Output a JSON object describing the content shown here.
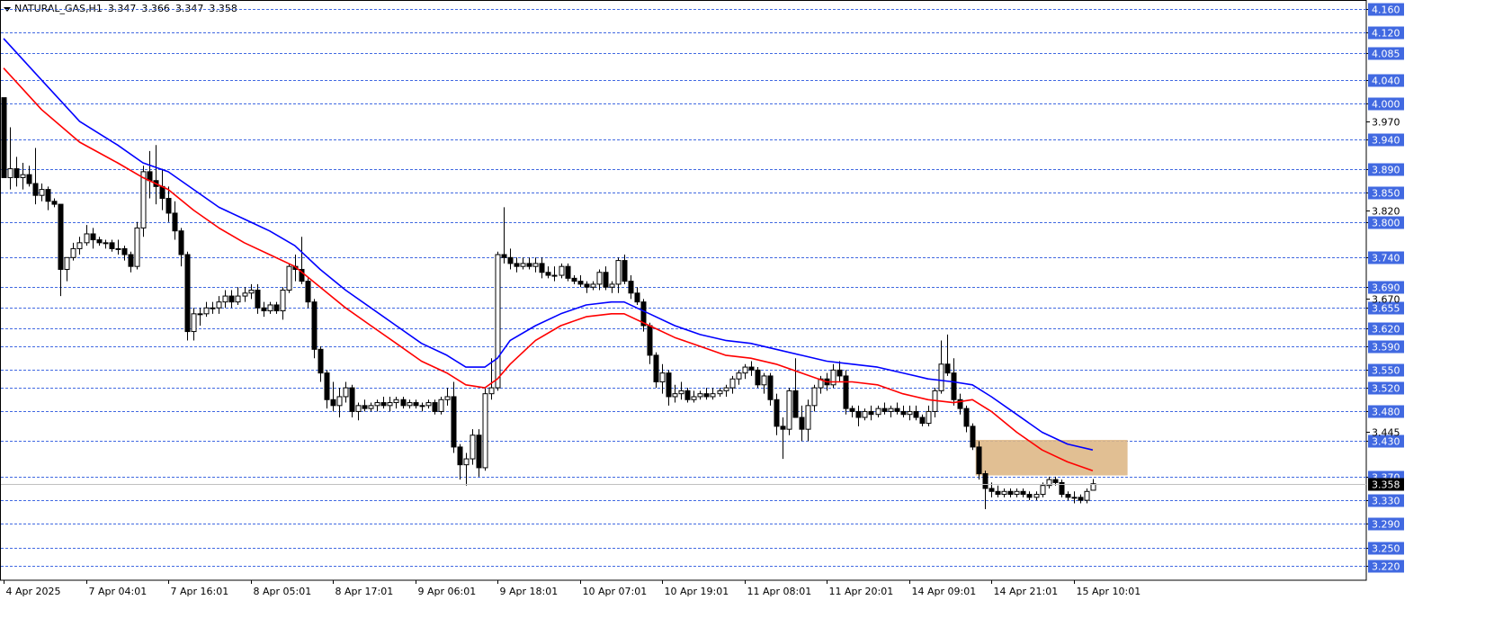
{
  "header": {
    "symbol_label": "NATURAL_GAS,H1",
    "open": "3.347",
    "high": "3.366",
    "low": "3.347",
    "close": "3.358"
  },
  "colors": {
    "background": "#ffffff",
    "grid": "#4169e1",
    "candle": "#000000",
    "ma_fast": "#ff0000",
    "ma_slow": "#0000ff",
    "zone": "#deb887",
    "price_tag_bg": "#4169e1",
    "price_tag_text": "#ffffff",
    "current_tag_bg": "#000000"
  },
  "chart_data": {
    "type": "candlestick",
    "ylim": [
      3.195,
      4.175
    ],
    "grid_levels": [
      "4.160",
      "4.120",
      "4.085",
      "4.040",
      "4.000",
      "3.940",
      "3.890",
      "3.850",
      "3.800",
      "3.740",
      "3.690",
      "3.655",
      "3.620",
      "3.590",
      "3.550",
      "3.520",
      "3.480",
      "3.430",
      "3.370",
      "3.330",
      "3.290",
      "3.250",
      "3.220"
    ],
    "plain_ticks": [
      "3.970",
      "3.820",
      "3.670",
      "3.445"
    ],
    "current_price": "3.358",
    "x_tick_labels": [
      "4 Apr 2025",
      "7 Apr 04:01",
      "7 Apr 16:01",
      "8 Apr 05:01",
      "8 Apr 17:01",
      "9 Apr 06:01",
      "9 Apr 18:01",
      "10 Apr 07:01",
      "10 Apr 19:01",
      "11 Apr 08:01",
      "11 Apr 20:01",
      "14 Apr 09:01",
      "14 Apr 21:01",
      "15 Apr 10:01"
    ],
    "x_tick_bars": [
      0,
      13,
      26,
      39,
      52,
      65,
      78,
      91,
      104,
      117,
      130,
      143,
      156,
      169
    ],
    "candles": [
      [
        4.01,
        4.01,
        3.895,
        3.875
      ],
      [
        3.875,
        3.96,
        3.855,
        3.89
      ],
      [
        3.89,
        3.91,
        3.86,
        3.875
      ],
      [
        3.875,
        3.9,
        3.855,
        3.88
      ],
      [
        3.88,
        3.895,
        3.86,
        3.865
      ],
      [
        3.865,
        3.925,
        3.83,
        3.845
      ],
      [
        3.845,
        3.865,
        3.835,
        3.855
      ],
      [
        3.855,
        3.86,
        3.82,
        3.835
      ],
      [
        3.835,
        3.84,
        3.825,
        3.83
      ],
      [
        3.83,
        3.78,
        3.675,
        3.72
      ],
      [
        3.72,
        3.74,
        3.7,
        3.74
      ],
      [
        3.74,
        3.765,
        3.735,
        3.755
      ],
      [
        3.755,
        3.775,
        3.745,
        3.765
      ],
      [
        3.765,
        3.795,
        3.76,
        3.78
      ],
      [
        3.78,
        3.79,
        3.755,
        3.77
      ],
      [
        3.77,
        3.775,
        3.76,
        3.765
      ],
      [
        3.765,
        3.77,
        3.755,
        3.765
      ],
      [
        3.765,
        3.77,
        3.75,
        3.755
      ],
      [
        3.755,
        3.77,
        3.745,
        3.755
      ],
      [
        3.755,
        3.76,
        3.735,
        3.745
      ],
      [
        3.745,
        3.75,
        3.715,
        3.725
      ],
      [
        3.725,
        3.8,
        3.72,
        3.79
      ],
      [
        3.79,
        3.895,
        3.775,
        3.885
      ],
      [
        3.885,
        3.92,
        3.84,
        3.87
      ],
      [
        3.87,
        3.93,
        3.83,
        3.86
      ],
      [
        3.86,
        3.89,
        3.82,
        3.84
      ],
      [
        3.84,
        3.86,
        3.8,
        3.815
      ],
      [
        3.815,
        3.835,
        3.77,
        3.785
      ],
      [
        3.785,
        3.79,
        3.725,
        3.745
      ],
      [
        3.745,
        3.75,
        3.6,
        3.615
      ],
      [
        3.615,
        3.655,
        3.6,
        3.645
      ],
      [
        3.645,
        3.655,
        3.625,
        3.645
      ],
      [
        3.645,
        3.665,
        3.64,
        3.655
      ],
      [
        3.655,
        3.665,
        3.645,
        3.655
      ],
      [
        3.655,
        3.675,
        3.645,
        3.665
      ],
      [
        3.665,
        3.685,
        3.655,
        3.675
      ],
      [
        3.675,
        3.685,
        3.655,
        3.665
      ],
      [
        3.665,
        3.69,
        3.66,
        3.675
      ],
      [
        3.675,
        3.69,
        3.665,
        3.68
      ],
      [
        3.68,
        3.695,
        3.67,
        3.685
      ],
      [
        3.685,
        3.695,
        3.645,
        3.655
      ],
      [
        3.655,
        3.665,
        3.64,
        3.65
      ],
      [
        3.65,
        3.665,
        3.645,
        3.66
      ],
      [
        3.66,
        3.665,
        3.645,
        3.65
      ],
      [
        3.65,
        3.69,
        3.635,
        3.685
      ],
      [
        3.685,
        3.73,
        3.68,
        3.725
      ],
      [
        3.725,
        3.745,
        3.7,
        3.72
      ],
      [
        3.72,
        3.775,
        3.695,
        3.7
      ],
      [
        3.7,
        3.705,
        3.655,
        3.665
      ],
      [
        3.665,
        3.67,
        3.57,
        3.585
      ],
      [
        3.585,
        3.59,
        3.53,
        3.545
      ],
      [
        3.545,
        3.55,
        3.485,
        3.5
      ],
      [
        3.5,
        3.53,
        3.48,
        3.49
      ],
      [
        3.49,
        3.52,
        3.47,
        3.505
      ],
      [
        3.505,
        3.53,
        3.495,
        3.52
      ],
      [
        3.52,
        3.525,
        3.47,
        3.48
      ],
      [
        3.48,
        3.495,
        3.465,
        3.49
      ],
      [
        3.49,
        3.5,
        3.48,
        3.485
      ],
      [
        3.485,
        3.495,
        3.48,
        3.49
      ],
      [
        3.49,
        3.5,
        3.48,
        3.495
      ],
      [
        3.495,
        3.505,
        3.485,
        3.49
      ],
      [
        3.49,
        3.505,
        3.48,
        3.495
      ],
      [
        3.495,
        3.505,
        3.485,
        3.5
      ],
      [
        3.5,
        3.505,
        3.485,
        3.49
      ],
      [
        3.49,
        3.5,
        3.485,
        3.495
      ],
      [
        3.495,
        3.5,
        3.485,
        3.49
      ],
      [
        3.49,
        3.495,
        3.48,
        3.49
      ],
      [
        3.49,
        3.5,
        3.485,
        3.495
      ],
      [
        3.495,
        3.5,
        3.475,
        3.48
      ],
      [
        3.48,
        3.505,
        3.475,
        3.5
      ],
      [
        3.5,
        3.52,
        3.49,
        3.505
      ],
      [
        3.505,
        3.53,
        3.41,
        3.42
      ],
      [
        3.42,
        3.425,
        3.365,
        3.39
      ],
      [
        3.39,
        3.41,
        3.355,
        3.4
      ],
      [
        3.4,
        3.45,
        3.39,
        3.44
      ],
      [
        3.44,
        3.45,
        3.37,
        3.385
      ],
      [
        3.385,
        3.52,
        3.38,
        3.51
      ],
      [
        3.51,
        3.57,
        3.5,
        3.52
      ],
      [
        3.52,
        3.75,
        3.515,
        3.745
      ],
      [
        3.745,
        3.825,
        3.73,
        3.74
      ],
      [
        3.74,
        3.755,
        3.72,
        3.73
      ],
      [
        3.73,
        3.74,
        3.715,
        3.725
      ],
      [
        3.725,
        3.74,
        3.72,
        3.73
      ],
      [
        3.73,
        3.74,
        3.72,
        3.725
      ],
      [
        3.725,
        3.74,
        3.715,
        3.73
      ],
      [
        3.73,
        3.74,
        3.705,
        3.715
      ],
      [
        3.715,
        3.725,
        3.705,
        3.71
      ],
      [
        3.71,
        3.725,
        3.7,
        3.71
      ],
      [
        3.71,
        3.73,
        3.705,
        3.725
      ],
      [
        3.725,
        3.73,
        3.7,
        3.705
      ],
      [
        3.705,
        3.71,
        3.695,
        3.7
      ],
      [
        3.7,
        3.71,
        3.69,
        3.695
      ],
      [
        3.695,
        3.7,
        3.68,
        3.69
      ],
      [
        3.69,
        3.7,
        3.685,
        3.695
      ],
      [
        3.695,
        3.72,
        3.685,
        3.715
      ],
      [
        3.715,
        3.725,
        3.685,
        3.69
      ],
      [
        3.69,
        3.7,
        3.68,
        3.695
      ],
      [
        3.695,
        3.74,
        3.68,
        3.735
      ],
      [
        3.735,
        3.745,
        3.695,
        3.7
      ],
      [
        3.7,
        3.71,
        3.67,
        3.68
      ],
      [
        3.68,
        3.69,
        3.66,
        3.665
      ],
      [
        3.665,
        3.67,
        3.615,
        3.625
      ],
      [
        3.625,
        3.63,
        3.56,
        3.575
      ],
      [
        3.575,
        3.58,
        3.52,
        3.53
      ],
      [
        3.53,
        3.56,
        3.51,
        3.545
      ],
      [
        3.545,
        3.55,
        3.49,
        3.505
      ],
      [
        3.505,
        3.525,
        3.495,
        3.51
      ],
      [
        3.51,
        3.53,
        3.5,
        3.515
      ],
      [
        3.515,
        3.52,
        3.495,
        3.5
      ],
      [
        3.5,
        3.515,
        3.495,
        3.505
      ],
      [
        3.505,
        3.515,
        3.5,
        3.51
      ],
      [
        3.51,
        3.52,
        3.5,
        3.505
      ],
      [
        3.505,
        3.52,
        3.5,
        3.51
      ],
      [
        3.51,
        3.52,
        3.505,
        3.515
      ],
      [
        3.515,
        3.525,
        3.505,
        3.52
      ],
      [
        3.52,
        3.54,
        3.51,
        3.535
      ],
      [
        3.535,
        3.55,
        3.525,
        3.545
      ],
      [
        3.545,
        3.56,
        3.535,
        3.555
      ],
      [
        3.555,
        3.565,
        3.54,
        3.55
      ],
      [
        3.55,
        3.555,
        3.52,
        3.525
      ],
      [
        3.525,
        3.545,
        3.51,
        3.54
      ],
      [
        3.54,
        3.545,
        3.49,
        3.5
      ],
      [
        3.5,
        3.51,
        3.44,
        3.455
      ],
      [
        3.455,
        3.47,
        3.4,
        3.45
      ],
      [
        3.45,
        3.52,
        3.44,
        3.515
      ],
      [
        3.515,
        3.57,
        3.48,
        3.47
      ],
      [
        3.47,
        3.49,
        3.43,
        3.45
      ],
      [
        3.45,
        3.5,
        3.43,
        3.49
      ],
      [
        3.49,
        3.525,
        3.48,
        3.52
      ],
      [
        3.52,
        3.54,
        3.51,
        3.535
      ],
      [
        3.535,
        3.545,
        3.515,
        3.525
      ],
      [
        3.525,
        3.56,
        3.52,
        3.55
      ],
      [
        3.55,
        3.565,
        3.53,
        3.54
      ],
      [
        3.54,
        3.55,
        3.475,
        3.485
      ],
      [
        3.485,
        3.49,
        3.47,
        3.48
      ],
      [
        3.48,
        3.49,
        3.455,
        3.47
      ],
      [
        3.47,
        3.485,
        3.465,
        3.48
      ],
      [
        3.48,
        3.49,
        3.465,
        3.475
      ],
      [
        3.475,
        3.49,
        3.47,
        3.485
      ],
      [
        3.485,
        3.495,
        3.475,
        3.48
      ],
      [
        3.48,
        3.49,
        3.47,
        3.485
      ],
      [
        3.485,
        3.495,
        3.475,
        3.48
      ],
      [
        3.48,
        3.49,
        3.47,
        3.475
      ],
      [
        3.475,
        3.49,
        3.465,
        3.48
      ],
      [
        3.48,
        3.49,
        3.465,
        3.47
      ],
      [
        3.47,
        3.475,
        3.455,
        3.46
      ],
      [
        3.46,
        3.49,
        3.455,
        3.48
      ],
      [
        3.48,
        3.52,
        3.47,
        3.515
      ],
      [
        3.515,
        3.6,
        3.51,
        3.56
      ],
      [
        3.56,
        3.61,
        3.54,
        3.545
      ],
      [
        3.545,
        3.57,
        3.49,
        3.5
      ],
      [
        3.5,
        3.51,
        3.475,
        3.485
      ],
      [
        3.485,
        3.49,
        3.445,
        3.455
      ],
      [
        3.455,
        3.46,
        3.415,
        3.42
      ],
      [
        3.42,
        3.43,
        3.365,
        3.375
      ],
      [
        3.375,
        3.38,
        3.315,
        3.35
      ],
      [
        3.35,
        3.36,
        3.335,
        3.345
      ],
      [
        3.345,
        3.355,
        3.335,
        3.34
      ],
      [
        3.34,
        3.35,
        3.335,
        3.345
      ],
      [
        3.345,
        3.35,
        3.335,
        3.34
      ],
      [
        3.34,
        3.35,
        3.335,
        3.345
      ],
      [
        3.345,
        3.35,
        3.335,
        3.34
      ],
      [
        3.34,
        3.345,
        3.33,
        3.335
      ],
      [
        3.335,
        3.345,
        3.33,
        3.34
      ],
      [
        3.34,
        3.36,
        3.335,
        3.355
      ],
      [
        3.355,
        3.37,
        3.35,
        3.365
      ],
      [
        3.365,
        3.37,
        3.355,
        3.36
      ],
      [
        3.36,
        3.365,
        3.335,
        3.34
      ],
      [
        3.34,
        3.345,
        3.33,
        3.335
      ],
      [
        3.335,
        3.345,
        3.325,
        3.335
      ],
      [
        3.335,
        3.34,
        3.325,
        3.33
      ],
      [
        3.33,
        3.35,
        3.325,
        3.345
      ],
      [
        3.347,
        3.366,
        3.347,
        3.358
      ]
    ],
    "ma_fast": [
      [
        0,
        4.06
      ],
      [
        6,
        3.99
      ],
      [
        12,
        3.935
      ],
      [
        18,
        3.9
      ],
      [
        22,
        3.875
      ],
      [
        26,
        3.855
      ],
      [
        30,
        3.82
      ],
      [
        34,
        3.79
      ],
      [
        38,
        3.765
      ],
      [
        42,
        3.745
      ],
      [
        46,
        3.725
      ],
      [
        50,
        3.69
      ],
      [
        54,
        3.655
      ],
      [
        58,
        3.625
      ],
      [
        62,
        3.595
      ],
      [
        66,
        3.565
      ],
      [
        70,
        3.545
      ],
      [
        73,
        3.525
      ],
      [
        76,
        3.52
      ],
      [
        78,
        3.535
      ],
      [
        80,
        3.56
      ],
      [
        84,
        3.6
      ],
      [
        88,
        3.625
      ],
      [
        92,
        3.64
      ],
      [
        96,
        3.645
      ],
      [
        98,
        3.645
      ],
      [
        102,
        3.625
      ],
      [
        106,
        3.605
      ],
      [
        110,
        3.59
      ],
      [
        114,
        3.575
      ],
      [
        118,
        3.57
      ],
      [
        122,
        3.56
      ],
      [
        126,
        3.545
      ],
      [
        130,
        3.53
      ],
      [
        134,
        3.53
      ],
      [
        138,
        3.525
      ],
      [
        142,
        3.51
      ],
      [
        146,
        3.5
      ],
      [
        150,
        3.495
      ],
      [
        153,
        3.5
      ],
      [
        156,
        3.48
      ],
      [
        160,
        3.445
      ],
      [
        164,
        3.415
      ],
      [
        168,
        3.395
      ],
      [
        172,
        3.38
      ]
    ],
    "ma_slow": [
      [
        0,
        4.11
      ],
      [
        6,
        4.04
      ],
      [
        12,
        3.97
      ],
      [
        18,
        3.93
      ],
      [
        22,
        3.9
      ],
      [
        26,
        3.885
      ],
      [
        30,
        3.855
      ],
      [
        34,
        3.825
      ],
      [
        38,
        3.805
      ],
      [
        42,
        3.785
      ],
      [
        46,
        3.76
      ],
      [
        50,
        3.72
      ],
      [
        54,
        3.685
      ],
      [
        58,
        3.655
      ],
      [
        62,
        3.625
      ],
      [
        66,
        3.595
      ],
      [
        70,
        3.575
      ],
      [
        73,
        3.555
      ],
      [
        76,
        3.555
      ],
      [
        78,
        3.57
      ],
      [
        80,
        3.6
      ],
      [
        84,
        3.625
      ],
      [
        88,
        3.645
      ],
      [
        92,
        3.66
      ],
      [
        96,
        3.665
      ],
      [
        98,
        3.665
      ],
      [
        102,
        3.645
      ],
      [
        106,
        3.625
      ],
      [
        110,
        3.61
      ],
      [
        114,
        3.6
      ],
      [
        118,
        3.595
      ],
      [
        122,
        3.585
      ],
      [
        126,
        3.575
      ],
      [
        130,
        3.565
      ],
      [
        134,
        3.56
      ],
      [
        138,
        3.555
      ],
      [
        142,
        3.545
      ],
      [
        146,
        3.535
      ],
      [
        150,
        3.53
      ],
      [
        153,
        3.525
      ],
      [
        156,
        3.505
      ],
      [
        160,
        3.475
      ],
      [
        164,
        3.445
      ],
      [
        168,
        3.425
      ],
      [
        172,
        3.415
      ]
    ],
    "zone": {
      "y_top": 3.432,
      "y_bottom": 3.372,
      "bar_start": 153.5,
      "bar_end": 177.5
    }
  }
}
